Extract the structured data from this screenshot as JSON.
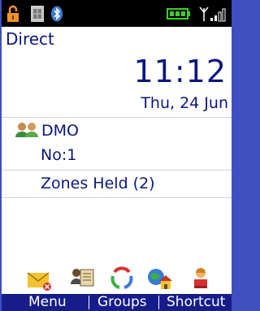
{
  "status_bar": {
    "icons": [
      "lock-icon",
      "sim-icon",
      "bluetooth-icon",
      "battery-icon",
      "signal-icon"
    ],
    "colors": {
      "background": "#000000",
      "battery": "#3ccf2a",
      "signal": "#ffffff"
    }
  },
  "mode": {
    "label": "Direct"
  },
  "clock": {
    "time": "11:12",
    "date": "Thu, 24 Jun"
  },
  "talkgroup": {
    "icon": "group-icon",
    "name": "DMO",
    "number": "No:1",
    "zones": "Zones Held (2)"
  },
  "tray": {
    "icons": [
      "messages-icon",
      "contacts-icon",
      "sync-icon",
      "home-network-icon",
      "user-icon"
    ]
  },
  "softkeys": {
    "left": "Menu",
    "center": "Groups",
    "right": "Shortcut"
  },
  "colors": {
    "text": "#0a1680",
    "softkey_bar": "#161d8a",
    "frame": "#3f4fc0"
  }
}
